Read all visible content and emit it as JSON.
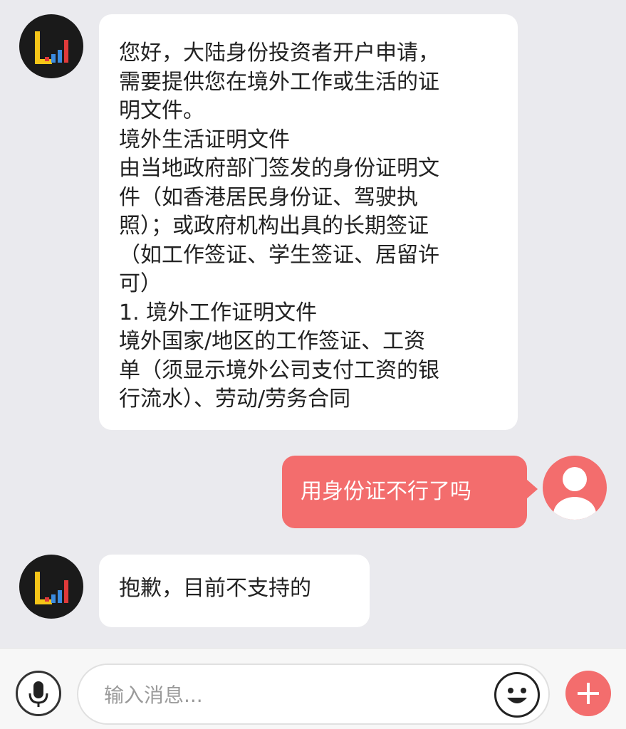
{
  "messages": [
    {
      "sender": "bot",
      "lines": [
        "您好，大陆身份投资者开户申请，",
        "需要提供您在境外工作或生活的证",
        "明文件。",
        "境外生活证明文件",
        "由当地政府部门签发的身份证明文",
        "件（如香港居民身份证、驾驶执",
        "照）；或政府机构出具的长期签证",
        "（如工作签证、学生签证、居留许",
        "可）",
        "1. 境外工作证明文件",
        "境外国家/地区的工作签证、工资",
        "单（须显示境外公司支付工资的银",
        "行流水）、劳动/劳务合同"
      ]
    },
    {
      "sender": "user",
      "text": "用身份证不行了吗"
    },
    {
      "sender": "bot",
      "lines": [
        "抱歉，目前不支持的"
      ]
    }
  ],
  "input": {
    "placeholder": "输入消息..."
  },
  "icons": {
    "voice": "microphone-icon",
    "emoji": "smiley-icon",
    "more": "plus-icon",
    "bot_avatar": "bar-chart-logo-icon",
    "user_avatar": "person-icon"
  },
  "colors": {
    "accent": "#f36d6d",
    "background": "#eaeaee",
    "bubble_bot": "#ffffff"
  }
}
